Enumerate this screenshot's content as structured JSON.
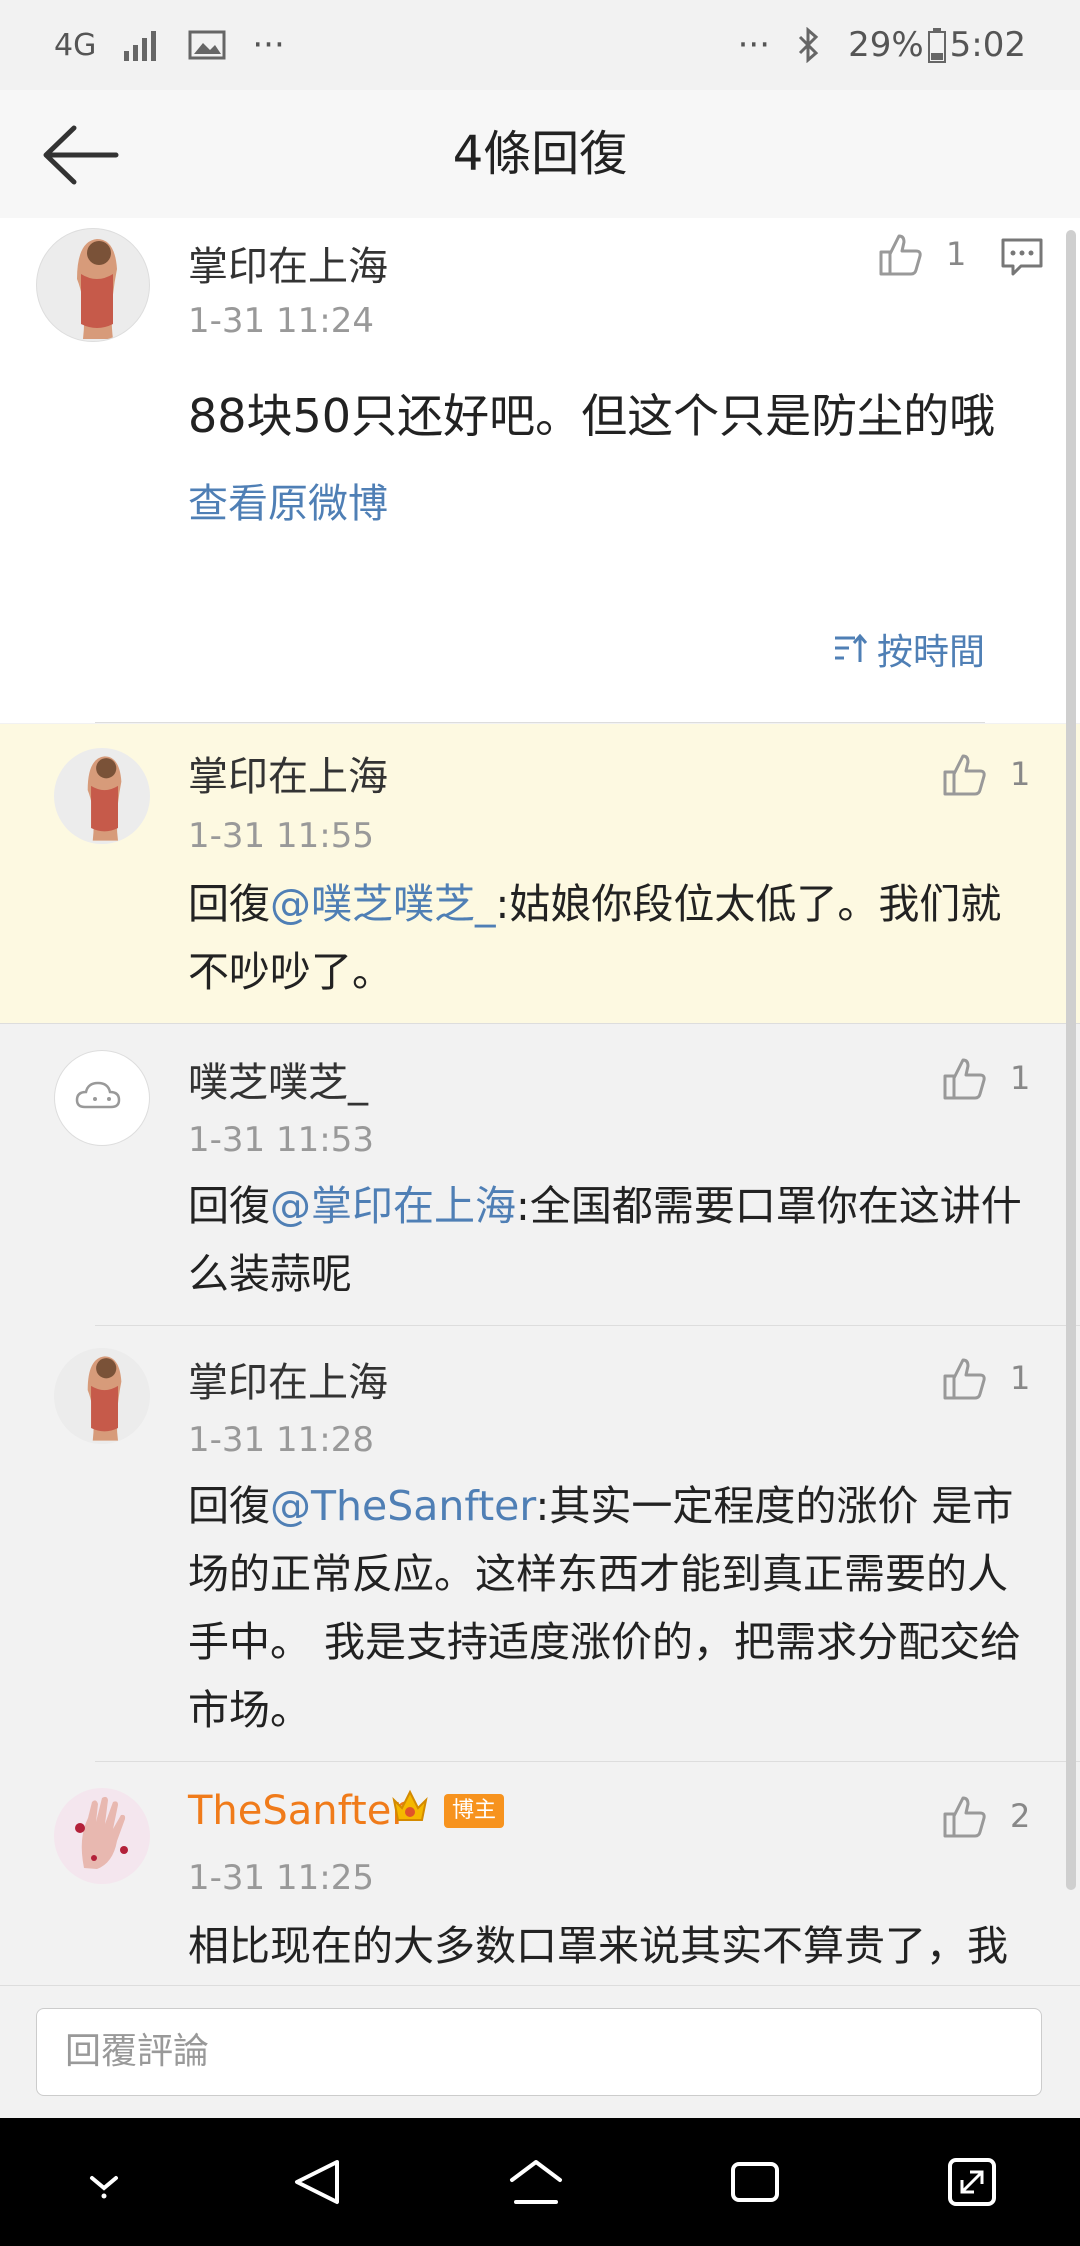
{
  "statusbar": {
    "network": "4G",
    "dots_left": "···",
    "dots_right": "···",
    "battery": "29%",
    "time": "5:02"
  },
  "header": {
    "title": "4條回復"
  },
  "main_post": {
    "author": "掌印在上海",
    "time": "1-31 11:24",
    "likes": "1",
    "text": "88块50只还好吧。但这个只是防尘的哦",
    "view_original": "查看原微博",
    "sort_label": "按時間"
  },
  "replies": [
    {
      "author": "掌印在上海",
      "time": "1-31 11:55",
      "likes": "1",
      "prefix": "回復",
      "mention": "@噗芝噗芝_",
      "text": ":姑娘你段位太低了。我们就不吵吵了。"
    },
    {
      "author": "噗芝噗芝_",
      "time": "1-31 11:53",
      "likes": "1",
      "prefix": "回復",
      "mention": "@掌印在上海",
      "text": ":全国都需要口罩你在这讲什么装蒜呢"
    },
    {
      "author": "掌印在上海",
      "time": "1-31 11:28",
      "likes": "1",
      "prefix": "回復",
      "mention": "@TheSanfter",
      "text": ":其实一定程度的涨价 是市场的正常反应。这样东西才能到真正需要的人手中。 我是支持适度涨价的，把需求分配交给市场。"
    },
    {
      "author": "TheSanfter",
      "badge": "博主",
      "time": "1-31 11:25",
      "likes": "2",
      "text": "相比现在的大多数口罩来说其实不算贵了，我"
    }
  ],
  "input": {
    "placeholder": "回覆評論"
  },
  "colors": {
    "link": "#4f7fb5",
    "highlight": "#fdf9e1",
    "author_orange": "#f07b1a"
  }
}
